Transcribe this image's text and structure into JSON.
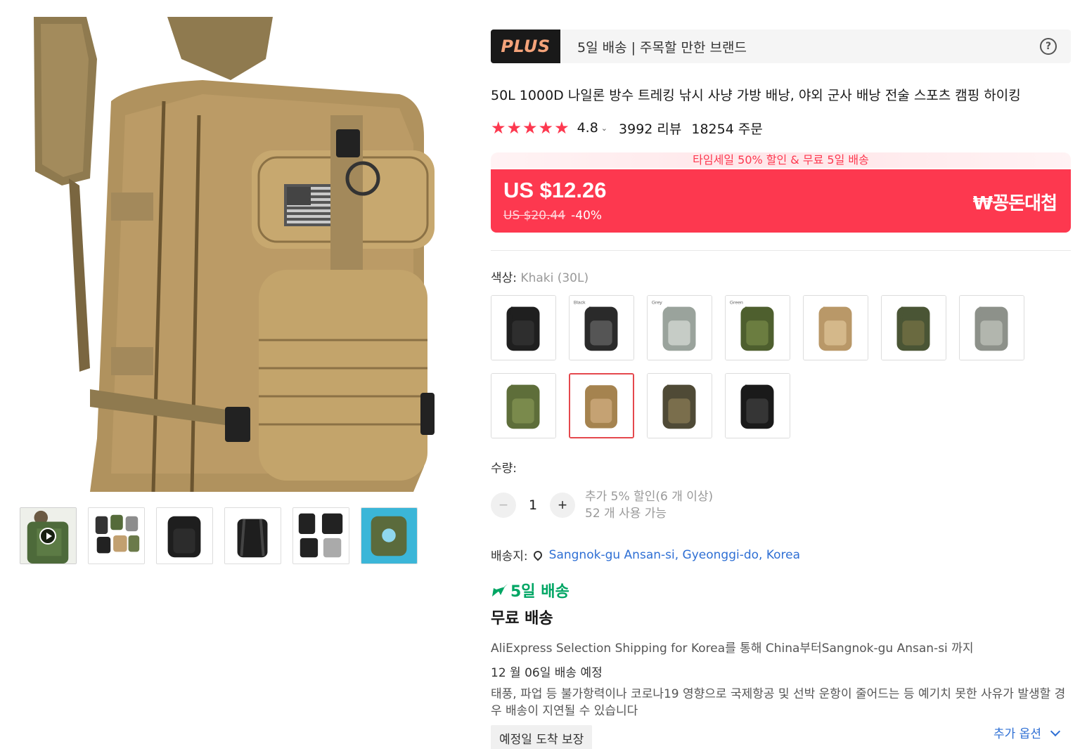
{
  "gallery": {
    "main_image_alt": "khaki tactical backpack with american flag patch",
    "thumbnails": [
      {
        "name": "video-thumbnail",
        "has_play": true
      },
      {
        "name": "color-grid-thumbnail",
        "has_play": false
      },
      {
        "name": "black-front-thumbnail",
        "has_play": false
      },
      {
        "name": "black-back-thumbnail",
        "has_play": false
      },
      {
        "name": "black-views-thumbnail",
        "has_play": false
      },
      {
        "name": "green-water-thumbnail",
        "has_play": false
      }
    ]
  },
  "plus_bar": {
    "logo": "PLUS",
    "text": "5일 배송 | 주목할 만한 브랜드",
    "help_icon": "help-icon"
  },
  "product": {
    "title": "50L 1000D 나일론 방수 트레킹 낚시 사냥 가방 배낭, 야외 군사 배낭 전술 스포츠 캠핑 하이킹",
    "stars": "★★★★★",
    "rating": "4.8",
    "rating_chevron": "⌄",
    "reviews": "3992 리뷰",
    "orders": "18254 주문"
  },
  "price": {
    "promo": "타임세일 50% 할인 & 무료 5일 배송",
    "current": "US $12.26",
    "original": "US $20.44",
    "discount": "-40%",
    "badge": "₩꽁돈대첩",
    "color": "#fd384f"
  },
  "options": {
    "color_label": "색상:",
    "color_value": "Khaki (30L)",
    "swatches": [
      {
        "label": "",
        "tone": "black"
      },
      {
        "label": "Black",
        "tone": "black-camo"
      },
      {
        "label": "Grey",
        "tone": "grey-camo"
      },
      {
        "label": "Green",
        "tone": "green"
      },
      {
        "label": "",
        "tone": "khaki"
      },
      {
        "label": "",
        "tone": "woodland"
      },
      {
        "label": "",
        "tone": "acu"
      },
      {
        "label": "",
        "tone": "green-small"
      },
      {
        "label": "",
        "tone": "khaki-small",
        "selected": true
      },
      {
        "label": "",
        "tone": "woodland-small"
      },
      {
        "label": "",
        "tone": "black-small"
      }
    ]
  },
  "quantity": {
    "label": "수량:",
    "value": "1",
    "minus": "−",
    "plus": "+",
    "discount_note": "추가 5% 할인(6 개 이상)",
    "available": "52 개 사용 가능"
  },
  "shipping": {
    "label": "배송지:",
    "address": "Sangnok-gu Ansan-si, Gyeonggi-do, Korea",
    "fast": "5일 배송",
    "free": "무료 배송",
    "via": "AliExpress Selection Shipping for Korea를 통해 China부터Sangnok-gu Ansan-si 까지",
    "eta": "12 월 06일 배송 예정",
    "notice": "태풍, 파업 등 불가항력이나 코로나19 영향으로 국제항공 및 선박 운항이 줄어드는 등 예기치 못한 사유가 발생할 경우 배송이 지연될 수 있습니다",
    "guarantee": "예정일 도착 보장",
    "more_options": "추가 옵션",
    "accent": "#00a664",
    "link_color": "#2e6fd4"
  }
}
